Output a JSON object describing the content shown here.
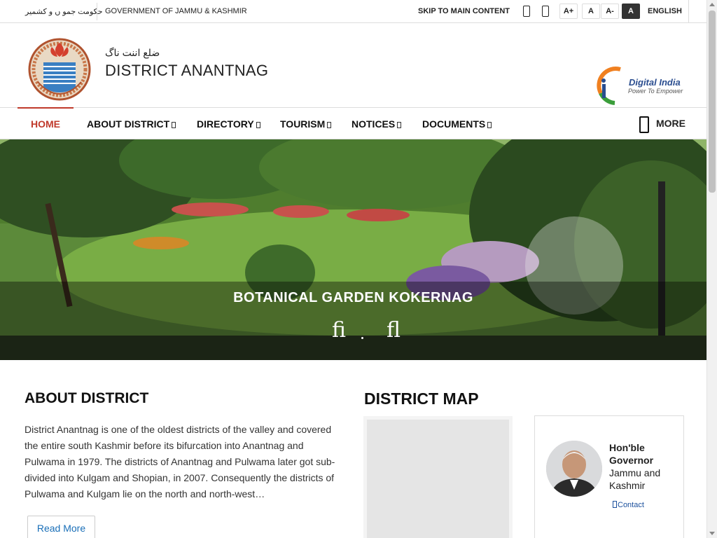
{
  "topbar": {
    "urdu_gov": "حکومت جمو ں و کشمیر",
    "gov_name": "GOVERNMENT OF JAMMU & KASHMIR",
    "skip_link": "SKIP TO MAIN CONTENT",
    "font_increase": "A+",
    "font_normal": "A",
    "font_decrease": "A-",
    "contrast": "A",
    "language": "ENGLISH"
  },
  "header": {
    "district_urdu": "ضلع اننت ناگ",
    "district_title": "DISTRICT ANANTNAG",
    "digital_india": "Digital India",
    "digital_india_tagline": "Power To Empower"
  },
  "nav": {
    "items": [
      {
        "label": "HOME",
        "active": true
      },
      {
        "label": "ABOUT DISTRICT",
        "active": false
      },
      {
        "label": "DIRECTORY",
        "active": false
      },
      {
        "label": "TOURISM",
        "active": false
      },
      {
        "label": "NOTICES",
        "active": false
      },
      {
        "label": "DOCUMENTS",
        "active": false
      }
    ],
    "more": "MORE"
  },
  "hero": {
    "caption": "BOTANICAL GARDEN KOKERNAG",
    "prev_glyph": "ﬁ",
    "next_glyph": "ﬂ"
  },
  "about": {
    "heading": "ABOUT DISTRICT",
    "text": "District Anantnag is one of the oldest districts of the valley and covered the entire south Kashmir before its bifurcation into Anantnag and Pulwama in 1979. The districts of Anantnag and Pulwama later got sub-divided into Kulgam and Shopian, in 2007. Consequently the districts of Pulwama and Kulgam lie on the north and north-west…",
    "read_more": "Read More"
  },
  "map": {
    "heading": "DISTRICT MAP"
  },
  "governor": {
    "title": "Hon'ble Governor",
    "subtitle": "Jammu and Kashmir",
    "contact": "Contact"
  },
  "colors": {
    "accent": "#c0392b",
    "link": "#1a6fb8"
  }
}
